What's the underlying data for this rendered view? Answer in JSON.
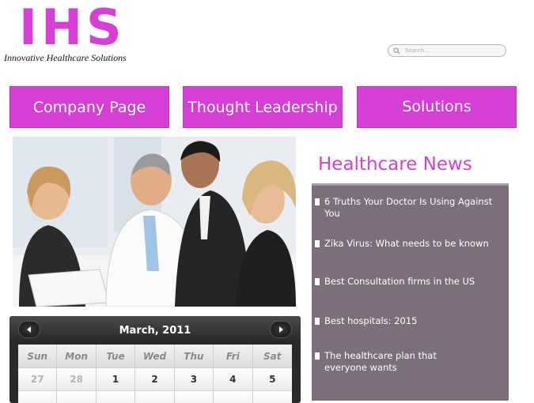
{
  "brand": {
    "logo": "IHS",
    "tagline": "Innovative Healthcare Solutions"
  },
  "search": {
    "placeholder": "Search..."
  },
  "nav": {
    "company": "Company Page",
    "thought": "Thought Leadership",
    "solutions": "Solutions"
  },
  "news": {
    "title": "Healthcare News",
    "items": [
      "6 Truths Your Doctor Is Using Against You",
      "Zika Virus: What needs to be known",
      "Best Consultation firms in the US",
      "Best hospitals: 2015",
      "The healthcare plan that everyone wants"
    ]
  },
  "calendar": {
    "month_label": "March, 2011",
    "weekdays": [
      "Sun",
      "Mon",
      "Tue",
      "Wed",
      "Thu",
      "Fri",
      "Sat"
    ],
    "week1": [
      "27",
      "28",
      "1",
      "2",
      "3",
      "4",
      "5"
    ]
  },
  "colors": {
    "brand": "#d63fd6",
    "news_panel": "#7d6e7c"
  }
}
